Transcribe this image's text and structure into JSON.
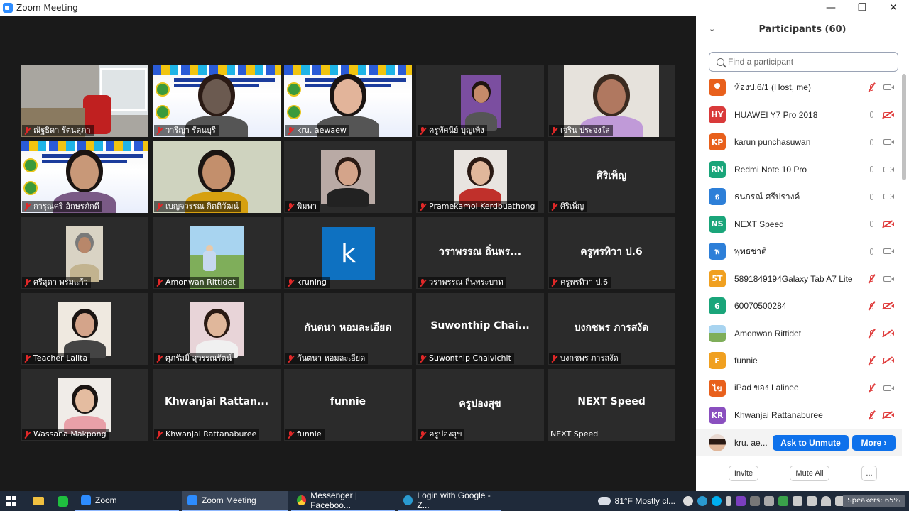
{
  "window": {
    "title": "Zoom Meeting",
    "controls": [
      "—",
      "❐",
      "✕"
    ]
  },
  "gallery": {
    "tiles": [
      {
        "label": "ณัฐธิดา รัตนสุภา",
        "muted": true,
        "big": ""
      },
      {
        "label": "วารีญา  รัตนบุรี",
        "muted": true,
        "big": ""
      },
      {
        "label": "kru. aewaew",
        "muted": true,
        "big": ""
      },
      {
        "label": "ครูทัศนีย์ บุญเพ็ง",
        "muted": true,
        "big": ""
      },
      {
        "label": "เจริน ประจงใส",
        "muted": true,
        "big": ""
      },
      {
        "label": "การุณศรี อักษรภักดี",
        "muted": true,
        "big": ""
      },
      {
        "label": "เบญจวรรณ กิตติวัฒน์",
        "muted": true,
        "big": ""
      },
      {
        "label": "พิมพา",
        "muted": true,
        "big": ""
      },
      {
        "label": "Pramekamol Kerdbuathong",
        "muted": true,
        "big": ""
      },
      {
        "label": "ศิริเพ็ญ",
        "muted": true,
        "big": "ศิริเพ็ญ"
      },
      {
        "label": "ศรีสุดา พรมแก้ว",
        "muted": true,
        "big": ""
      },
      {
        "label": "Amonwan Rittidet",
        "muted": true,
        "big": ""
      },
      {
        "label": "kruning",
        "muted": true,
        "big": "",
        "letter": "k"
      },
      {
        "label": "วราพรรณ ถิ่นพระบาท",
        "muted": true,
        "big": "วราพรรณ ถิ่นพร..."
      },
      {
        "label": "ครูพรทิวา ป.6",
        "muted": true,
        "big": "ครูพรทิวา ป.6"
      },
      {
        "label": "Teacher Lalita",
        "muted": true,
        "big": ""
      },
      {
        "label": "ศุภรัสมิ์ สุวรรณรัตน์",
        "muted": true,
        "big": ""
      },
      {
        "label": "กันตนา หอมละเอียด",
        "muted": true,
        "big": "กันตนา หอมละเอียด"
      },
      {
        "label": "Suwonthip Chaivichit",
        "muted": true,
        "big": "Suwonthip  Chai..."
      },
      {
        "label": "บงกชพร ภารสงัด",
        "muted": true,
        "big": "บงกชพร ภารสงัด"
      },
      {
        "label": "Wassana Makpong",
        "muted": true,
        "big": ""
      },
      {
        "label": "Khwanjai Rattanaburee",
        "muted": true,
        "big": "Khwanjai  Rattan..."
      },
      {
        "label": "funnie",
        "muted": true,
        "big": "funnie"
      },
      {
        "label": "ครูปองสุข",
        "muted": true,
        "big": "ครูปองสุข"
      },
      {
        "label": "NEXT Speed",
        "muted": false,
        "big": "NEXT Speed"
      }
    ]
  },
  "participants": {
    "title": "Participants (60)",
    "search_placeholder": "Find a participant",
    "list": [
      {
        "initials": "",
        "color": "#e8601c",
        "name": "ห้องป.6/1 (Host, me)",
        "mic": "off",
        "cam": "on",
        "avatar": "person-icon"
      },
      {
        "initials": "HY",
        "color": "#d93a3a",
        "name": "HUAWEI Y7 Pro 2018",
        "mic": "on",
        "cam": "off"
      },
      {
        "initials": "KP",
        "color": "#e8601c",
        "name": "karun punchasuwan",
        "mic": "on",
        "cam": "on"
      },
      {
        "initials": "RN",
        "color": "#1aa57a",
        "name": "Redmi Note 10 Pro",
        "mic": "on",
        "cam": "on"
      },
      {
        "initials": "ธ",
        "color": "#2d7fd8",
        "name": "ธนกรณ์  ศรีปรางค์",
        "mic": "on",
        "cam": "on"
      },
      {
        "initials": "NS",
        "color": "#1aa57a",
        "name": "NEXT Speed",
        "mic": "on",
        "cam": "off"
      },
      {
        "initials": "พ",
        "color": "#2d7fd8",
        "name": "พุทธชาติ",
        "mic": "on",
        "cam": "on"
      },
      {
        "initials": "5T",
        "color": "#f0a020",
        "name": "5891849194Galaxy Tab A7 Lite",
        "mic": "off",
        "cam": "on"
      },
      {
        "initials": "6",
        "color": "#1aa57a",
        "name": "60070500284",
        "mic": "off",
        "cam": "off"
      },
      {
        "initials": "",
        "color": "#6b9a5a",
        "name": "Amonwan Rittidet",
        "mic": "off",
        "cam": "off",
        "avatar": "photo"
      },
      {
        "initials": "F",
        "color": "#f0a020",
        "name": "funnie",
        "mic": "off",
        "cam": "off"
      },
      {
        "initials": "ไข",
        "color": "#e8601c",
        "name": "iPad ของ Lalinee",
        "mic": "off",
        "cam": "on"
      },
      {
        "initials": "KR",
        "color": "#8a4fbf",
        "name": "Khwanjai Rattanaburee",
        "mic": "off",
        "cam": "off"
      }
    ],
    "hover_row": {
      "name": "kru. ae...",
      "ask_unmute": "Ask to Unmute",
      "more": "More ›"
    },
    "footer": {
      "invite": "Invite",
      "mute_all": "Mute All",
      "more": "..."
    }
  },
  "taskbar": {
    "items": [
      {
        "label": "Zoom",
        "color": "#2d8cff"
      },
      {
        "label": "Zoom Meeting",
        "color": "#2d8cff"
      },
      {
        "label": "Messenger | Faceboo...",
        "color": "#e8a020"
      },
      {
        "label": "Login with Google - Z...",
        "color": "#2a9ad0"
      }
    ],
    "weather": "81°F  Mostly cl...",
    "speakers": "Speakers: 65%"
  }
}
